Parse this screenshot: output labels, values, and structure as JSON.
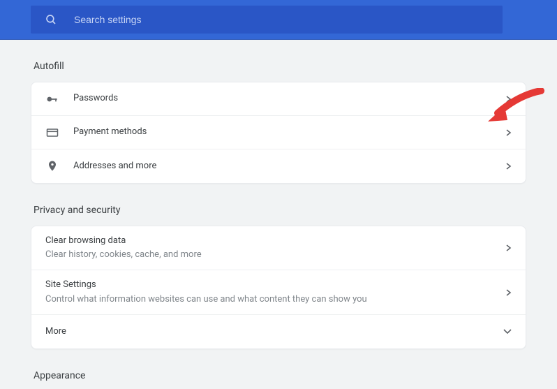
{
  "header": {
    "search_placeholder": "Search settings"
  },
  "sections": {
    "autofill": {
      "title": "Autofill",
      "rows": {
        "passwords": {
          "label": "Passwords"
        },
        "payment": {
          "label": "Payment methods"
        },
        "addresses": {
          "label": "Addresses and more"
        }
      }
    },
    "privacy": {
      "title": "Privacy and security",
      "rows": {
        "clear": {
          "label": "Clear browsing data",
          "sub": "Clear history, cookies, cache, and more"
        },
        "site": {
          "label": "Site Settings",
          "sub": "Control what information websites can use and what content they can show you"
        },
        "more": {
          "label": "More"
        }
      }
    },
    "appearance": {
      "title": "Appearance"
    }
  }
}
